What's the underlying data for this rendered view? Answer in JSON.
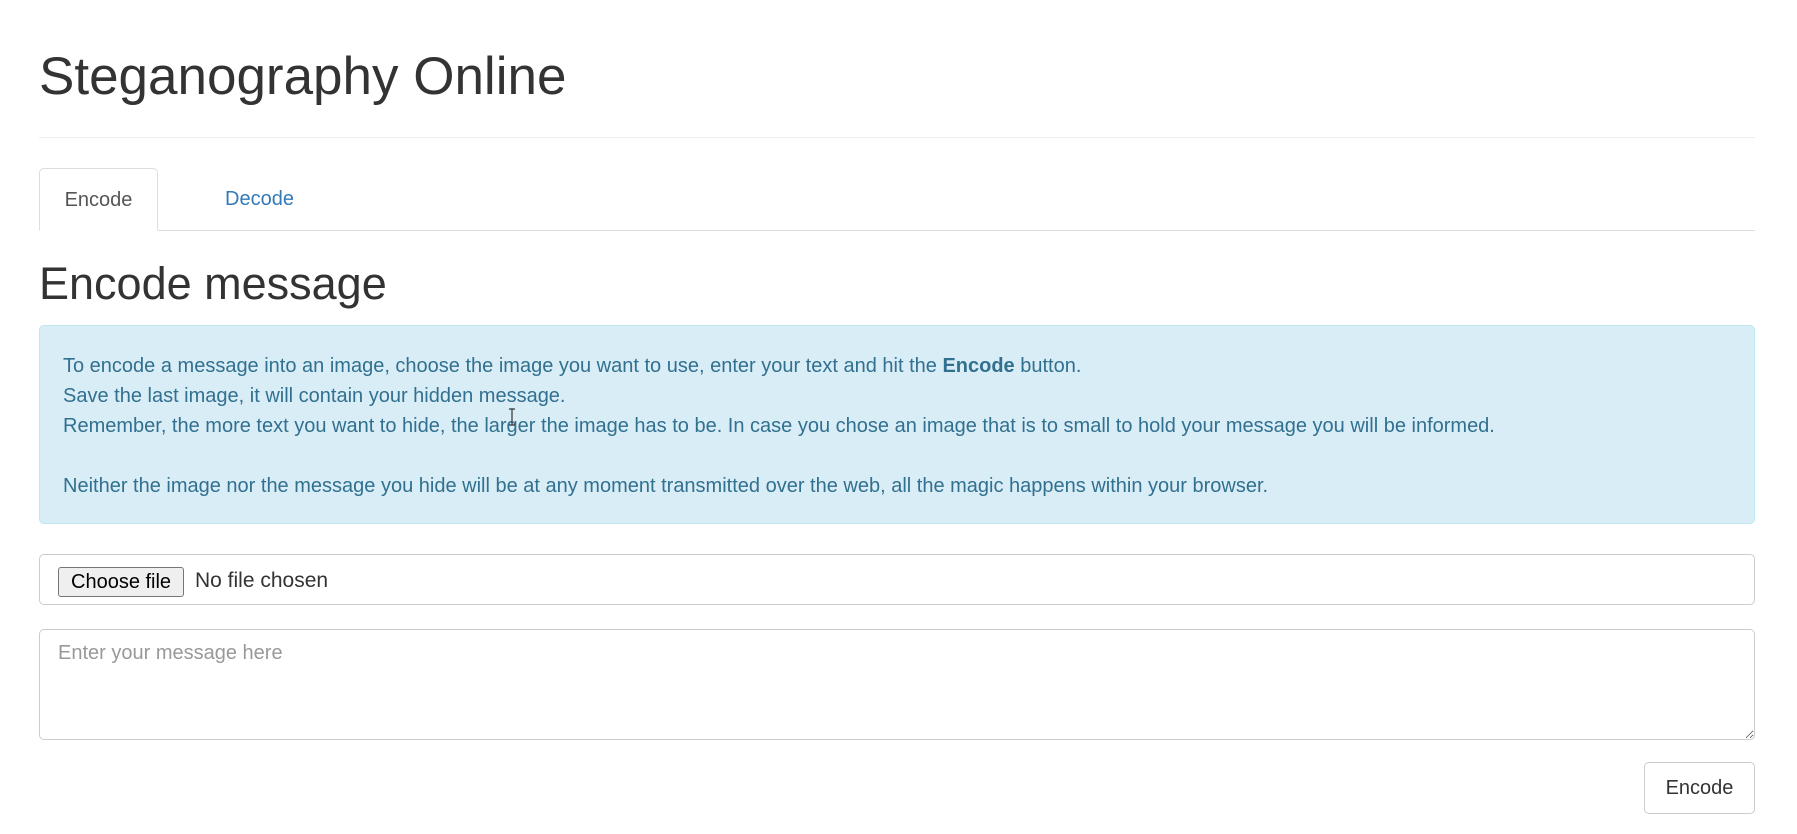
{
  "header": {
    "title": "Steganography Online"
  },
  "tabs": [
    {
      "label": "Encode",
      "active": true
    },
    {
      "label": "Decode",
      "active": false
    }
  ],
  "main": {
    "heading": "Encode message",
    "info": {
      "line1_before": "To encode a message into an image, choose the image you want to use, enter your text and hit the ",
      "line1_bold": "Encode",
      "line1_after": " button.",
      "line2": "Save the last image, it will contain your hidden message.",
      "line3": "Remember, the more text you want to hide, the larger the image has to be. In case you chose an image that is to small to hold your message you will be informed.",
      "line4": "Neither the image nor the message you hide will be at any moment transmitted over the web, all the magic happens within your browser."
    },
    "file_input": {
      "button_label": "Choose file",
      "status": "No file chosen"
    },
    "message_input": {
      "placeholder": "Enter your message here",
      "value": ""
    },
    "encode_button_label": "Encode"
  },
  "colors": {
    "info_background": "#d9edf7",
    "info_text": "#31708f",
    "link": "#337ab7"
  },
  "icons": {
    "cursor": "text-cursor-icon"
  }
}
